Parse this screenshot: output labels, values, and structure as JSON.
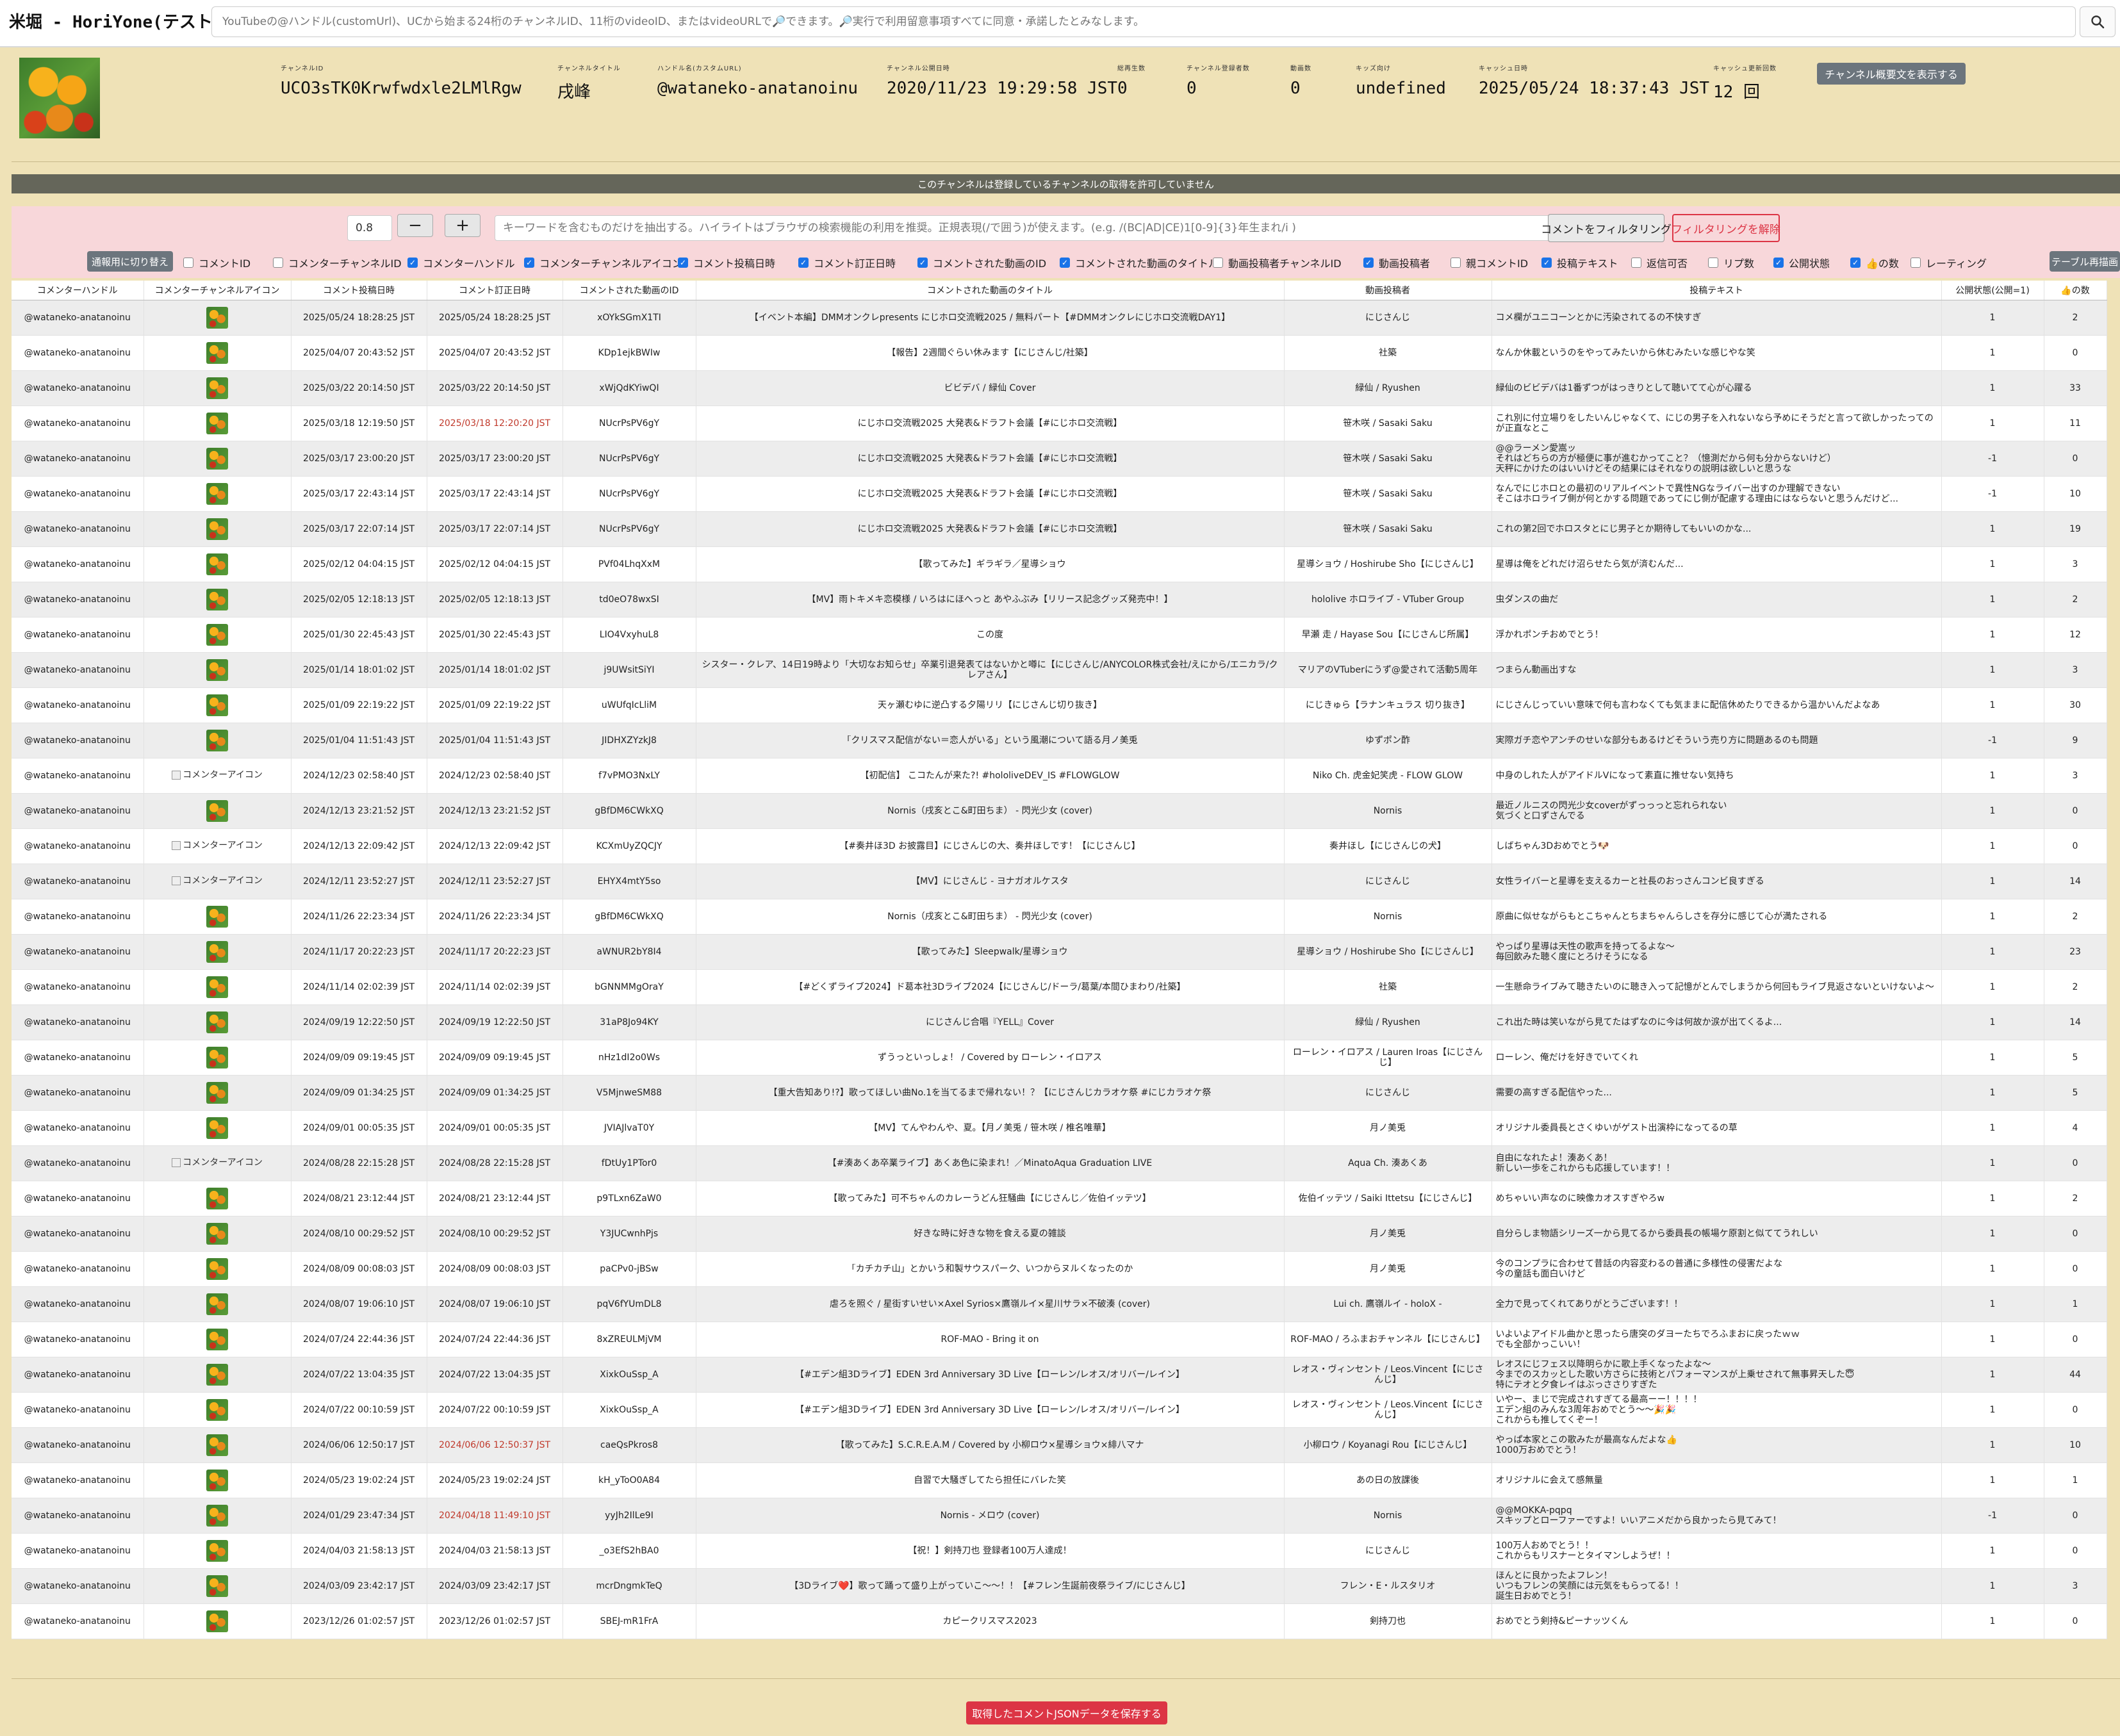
{
  "app": {
    "title": "米堀 - HoriYone(テスト中)",
    "search_placeholder": "YouTubeの@ハンドル(customUrl)、UCから始まる24桁のチャンネルID、11桁のvideoID、またはvideoURLで🔎できます。🔎実行で利用留意事項すべてに同意・承諾したとみなします。"
  },
  "channel": {
    "fields": [
      {
        "label": "チャンネルID",
        "value": "UCO3sTK0Krwfwdxle2LMlRgw"
      },
      {
        "label": "チャンネルタイトル",
        "value": "戌峰"
      },
      {
        "label": "ハンドル名(カスタムURL)",
        "value": "@wataneko-anatanoinu"
      },
      {
        "label": "チャンネル公開日時",
        "value": "2020/11/23 19:29:58 JST"
      },
      {
        "label": "総再生数",
        "value": "0"
      },
      {
        "label": "チャンネル登録者数",
        "value": "0"
      },
      {
        "label": "動画数",
        "value": "0"
      },
      {
        "label": "キッズ向け",
        "value": "undefined"
      },
      {
        "label": "キャッシュ日時",
        "value": "2025/05/24 18:37:43 JST"
      },
      {
        "label": "キャッシュ更新回数",
        "value": "12 回"
      }
    ],
    "desc_button": "チャンネル概要文を表示する"
  },
  "notice": "このチャンネルは登録しているチャンネルの取得を許可していません",
  "filter": {
    "threshold_value": "0.8",
    "minus": "−",
    "plus": "+",
    "keyword_placeholder": "キーワードを含むものだけを抽出する。ハイライトはブラウザの検索機能の利用を推奨。正規表現(/で囲う)が使えます。(e.g. /(BC|AD|CE)1[0-9]{3}年生まれ/i )",
    "filter_button": "コメントをフィルタリング",
    "clear_button": "フィルタリングを解除",
    "toggle_button": "通報用に切り替え",
    "redraw_button": "テーブル再描画",
    "columns": [
      {
        "label": "コメントID",
        "checked": false
      },
      {
        "label": "コメンターチャンネルID",
        "checked": false
      },
      {
        "label": "コメンターハンドル",
        "checked": true
      },
      {
        "label": "コメンターチャンネルアイコン",
        "checked": true
      },
      {
        "label": "コメント投稿日時",
        "checked": true
      },
      {
        "label": "コメント訂正日時",
        "checked": true
      },
      {
        "label": "コメントされた動画のID",
        "checked": true
      },
      {
        "label": "コメントされた動画のタイトル",
        "checked": true
      },
      {
        "label": "動画投稿者チャンネルID",
        "checked": false
      },
      {
        "label": "動画投稿者",
        "checked": true
      },
      {
        "label": "親コメントID",
        "checked": false
      },
      {
        "label": "投稿テキスト",
        "checked": true
      },
      {
        "label": "返信可否",
        "checked": false
      },
      {
        "label": "リプ数",
        "checked": false
      },
      {
        "label": "公開状態",
        "checked": true
      },
      {
        "label": "👍の数",
        "checked": true
      },
      {
        "label": "レーティング",
        "checked": false
      }
    ]
  },
  "table": {
    "headers": [
      "コメンターハンドル",
      "コメンターチャンネルアイコン",
      "コメント投稿日時",
      "コメント訂正日時",
      "コメントされた動画のID",
      "コメントされた動画のタイトル",
      "動画投稿者",
      "投稿テキスト",
      "公開状態(公開=1)",
      "👍の数"
    ],
    "broken_icon_alt": "コメンターアイコン",
    "rows": [
      {
        "handle": "@wataneko-anatanoinu",
        "icon": "img",
        "posted": "2025/05/24 18:28:25 JST",
        "edited": "2025/05/24 18:28:25 JST",
        "edited_red": false,
        "video_id": "xOYkSGmX1TI",
        "video_title": "【イベント本編】DMMオンクレpresents にじホロ交流戦2025 / 無料パート【#DMMオンクレにじホロ交流戦DAY1】",
        "uploader": "にじさんじ",
        "text": "コメ欄がユニコーンとかに汚染されてるの不快すぎ",
        "status": "1",
        "likes": "2"
      },
      {
        "handle": "@wataneko-anatanoinu",
        "icon": "img",
        "posted": "2025/04/07 20:43:52 JST",
        "edited": "2025/04/07 20:43:52 JST",
        "edited_red": false,
        "video_id": "KDp1ejkBWIw",
        "video_title": "【報告】2週間ぐらい休みます【にじさんじ/社築】",
        "uploader": "社築",
        "text": "なんか休載というのをやってみたいから休むみたいな感じやな笑",
        "status": "1",
        "likes": "0"
      },
      {
        "handle": "@wataneko-anatanoinu",
        "icon": "img",
        "posted": "2025/03/22 20:14:50 JST",
        "edited": "2025/03/22 20:14:50 JST",
        "edited_red": false,
        "video_id": "xWjQdKYiwQI",
        "video_title": "ビビデバ / 緑仙 Cover",
        "uploader": "緑仙 / Ryushen",
        "text": "緑仙のビビデバは1番ずつがはっきりとして聴いてて心が心躍る",
        "status": "1",
        "likes": "33"
      },
      {
        "handle": "@wataneko-anatanoinu",
        "icon": "img",
        "posted": "2025/03/18 12:19:50 JST",
        "edited": "2025/03/18 12:20:20 JST",
        "edited_red": true,
        "video_id": "NUcrPsPV6gY",
        "video_title": "にじホロ交流戦2025 大発表&ドラフト会議【#にじホロ交流戦】",
        "uploader": "笹木咲 / Sasaki Saku",
        "text": "これ別に付立場りをしたいんじゃなくて、にじの男子を入れないなら予めにそうだと言って欲しかったってのが正直なとこ",
        "status": "1",
        "likes": "11"
      },
      {
        "handle": "@wataneko-anatanoinu",
        "icon": "img",
        "posted": "2025/03/17 23:00:20 JST",
        "edited": "2025/03/17 23:00:20 JST",
        "edited_red": false,
        "video_id": "NUcrPsPV6gY",
        "video_title": "にじホロ交流戦2025 大発表&ドラフト会議【#にじホロ交流戦】",
        "uploader": "笹木咲 / Sasaki Saku",
        "text": "@@ラーメン愛嵩ッ\nそれはどちらの方が極便に事が進むかってこと？（憶測だから何も分からないけど）\n天秤にかけたのはいいけどその結果にはそれなりの説明は欲しいと思うな",
        "status": "-1",
        "likes": "0"
      },
      {
        "handle": "@wataneko-anatanoinu",
        "icon": "img",
        "posted": "2025/03/17 22:43:14 JST",
        "edited": "2025/03/17 22:43:14 JST",
        "edited_red": false,
        "video_id": "NUcrPsPV6gY",
        "video_title": "にじホロ交流戦2025 大発表&ドラフト会議【#にじホロ交流戦】",
        "uploader": "笹木咲 / Sasaki Saku",
        "text": "なんでにじホロとの最初のリアルイベントで異性NGなライバー出すのか理解できない\nそこはホロライブ側が何とかする問題であってにじ側が配慮する理由にはならないと思うんだけど...",
        "status": "-1",
        "likes": "10"
      },
      {
        "handle": "@wataneko-anatanoinu",
        "icon": "img",
        "posted": "2025/03/17 22:07:14 JST",
        "edited": "2025/03/17 22:07:14 JST",
        "edited_red": false,
        "video_id": "NUcrPsPV6gY",
        "video_title": "にじホロ交流戦2025 大発表&ドラフト会議【#にじホロ交流戦】",
        "uploader": "笹木咲 / Sasaki Saku",
        "text": "これの第2回でホロスタとにじ男子とか期待してもいいのかな...",
        "status": "1",
        "likes": "19"
      },
      {
        "handle": "@wataneko-anatanoinu",
        "icon": "img",
        "posted": "2025/02/12 04:04:15 JST",
        "edited": "2025/02/12 04:04:15 JST",
        "edited_red": false,
        "video_id": "PVf04LhqXxM",
        "video_title": "【歌ってみた】ギラギラ／星導ショウ",
        "uploader": "星導ショウ / Hoshirube Sho【にじさんじ】",
        "text": "星導は俺をどれだけ沼らせたら気が済むんだ...",
        "status": "1",
        "likes": "3"
      },
      {
        "handle": "@wataneko-anatanoinu",
        "icon": "img",
        "posted": "2025/02/05 12:18:13 JST",
        "edited": "2025/02/05 12:18:13 JST",
        "edited_red": false,
        "video_id": "td0eO78wxSI",
        "video_title": "【MV】雨トキメキ恋模様 / いろはにほへっと あやふぶみ【リリース記念グッズ発売中！】",
        "uploader": "hololive ホロライブ - VTuber Group",
        "text": "虫ダンスの曲だ",
        "status": "1",
        "likes": "2"
      },
      {
        "handle": "@wataneko-anatanoinu",
        "icon": "img",
        "posted": "2025/01/30 22:45:43 JST",
        "edited": "2025/01/30 22:45:43 JST",
        "edited_red": false,
        "video_id": "LIO4VxyhuL8",
        "video_title": "この度",
        "uploader": "早瀬 走 / Hayase Sou【にじさんじ所属】",
        "text": "浮かれポンチおめでとう！",
        "status": "1",
        "likes": "12"
      },
      {
        "handle": "@wataneko-anatanoinu",
        "icon": "img",
        "posted": "2025/01/14 18:01:02 JST",
        "edited": "2025/01/14 18:01:02 JST",
        "edited_red": false,
        "video_id": "j9UWsitSiYI",
        "video_title": "シスター・クレア、14日19時より「大切なお知らせ」卒業引退発表てはないかと噂に【にじさんじ/ANYCOLOR株式会社/えにから/エニカラ/クレアさん】",
        "uploader": "マリアのVTuberにうず@愛されて活動5周年",
        "text": "つまらん動画出すな",
        "status": "1",
        "likes": "3"
      },
      {
        "handle": "@wataneko-anatanoinu",
        "icon": "img",
        "posted": "2025/01/09 22:19:22 JST",
        "edited": "2025/01/09 22:19:22 JST",
        "edited_red": false,
        "video_id": "uWUfqIcLliM",
        "video_title": "天ヶ瀬むゆに逆凸する夕陽リリ【にじさんじ切り抜き】",
        "uploader": "にじきゅら【ラナンキュラス 切り抜き】",
        "text": "にじさんじっていい意味で何も言わなくても気ままに配信休めたりできるから温かいんだよなあ",
        "status": "1",
        "likes": "30"
      },
      {
        "handle": "@wataneko-anatanoinu",
        "icon": "img",
        "posted": "2025/01/04 11:51:43 JST",
        "edited": "2025/01/04 11:51:43 JST",
        "edited_red": false,
        "video_id": "JIDHXZYzkJ8",
        "video_title": "「クリスマス配信がない＝恋人がいる」という風潮について語る月ノ美兎",
        "uploader": "ゆずポン酢",
        "text": "実際ガチ恋やアンチのせいな部分もあるけどそういう売り方に問題あるのも問題",
        "status": "-1",
        "likes": "9"
      },
      {
        "handle": "@wataneko-anatanoinu",
        "icon": "broken",
        "posted": "2024/12/23 02:58:40 JST",
        "edited": "2024/12/23 02:58:40 JST",
        "edited_red": false,
        "video_id": "f7vPMO3NxLY",
        "video_title": "【初配信】 こコたんが来た?! #hololiveDEV_IS #FLOWGLOW",
        "uploader": "Niko Ch. 虎金妃笑虎 - FLOW GLOW",
        "text": "中身のしれた人がアイドルVになって素直に推せない気持ち",
        "status": "1",
        "likes": "3"
      },
      {
        "handle": "@wataneko-anatanoinu",
        "icon": "img",
        "posted": "2024/12/13 23:21:52 JST",
        "edited": "2024/12/13 23:21:52 JST",
        "edited_red": false,
        "video_id": "gBfDM6CWkXQ",
        "video_title": "Nornis（戌亥とこ&町田ちま） - 閃光少女 (cover)",
        "uploader": "Nornis",
        "text": "最近ノルニスの閃光少女coverがずっっっと忘れられない\n気づくと口ずさんでる",
        "status": "1",
        "likes": "0"
      },
      {
        "handle": "@wataneko-anatanoinu",
        "icon": "broken",
        "posted": "2024/12/13 22:09:42 JST",
        "edited": "2024/12/13 22:09:42 JST",
        "edited_red": false,
        "video_id": "KCXmUyZQCJY",
        "video_title": "【#奏井ほ3D お披露目】にじさんじの大、奏井ほしです！【にじさんじ】",
        "uploader": "奏井ほし【にじさんじの犬】",
        "text": "しばちゃん3Dおめでとう🐶",
        "status": "1",
        "likes": "0"
      },
      {
        "handle": "@wataneko-anatanoinu",
        "icon": "broken",
        "posted": "2024/12/11 23:52:27 JST",
        "edited": "2024/12/11 23:52:27 JST",
        "edited_red": false,
        "video_id": "EHYX4mtY5so",
        "video_title": "【MV】にじさんじ - ヨナガオルケスタ",
        "uploader": "にじさんじ",
        "text": "女性ライバーと星導を支えるカーと社長のおっさんコンビ良すぎる",
        "status": "1",
        "likes": "14"
      },
      {
        "handle": "@wataneko-anatanoinu",
        "icon": "img",
        "posted": "2024/11/26 22:23:34 JST",
        "edited": "2024/11/26 22:23:34 JST",
        "edited_red": false,
        "video_id": "gBfDM6CWkXQ",
        "video_title": "Nornis（戌亥とこ&町田ちま） - 閃光少女 (cover)",
        "uploader": "Nornis",
        "text": "原曲に似せながらもとこちゃんとちまちゃんらしさを存分に感じて心が満たされる",
        "status": "1",
        "likes": "2"
      },
      {
        "handle": "@wataneko-anatanoinu",
        "icon": "img",
        "posted": "2024/11/17 20:22:23 JST",
        "edited": "2024/11/17 20:22:23 JST",
        "edited_red": false,
        "video_id": "aWNUR2bY8I4",
        "video_title": "【歌ってみた】Sleepwalk/星導ショウ",
        "uploader": "星導ショウ / Hoshirube Sho【にじさんじ】",
        "text": "やっぱり星導は天性の歌声を持ってるよな〜\n毎回飲みた聴く度にとろけそうになる",
        "status": "1",
        "likes": "23"
      },
      {
        "handle": "@wataneko-anatanoinu",
        "icon": "img",
        "posted": "2024/11/14 02:02:39 JST",
        "edited": "2024/11/14 02:02:39 JST",
        "edited_red": false,
        "video_id": "bGNNMMgOraY",
        "video_title": "【#どくずライブ2024】ド葛本社3Dライブ2024【にじさんじ/ドーラ/葛葉/本間ひまわり/社築】",
        "uploader": "社築",
        "text": "一生懸命ライブみて聴きたいのに聴き入って記憶がとんでしまうから何回もライブ見返さないといけないよ〜",
        "status": "1",
        "likes": "2"
      },
      {
        "handle": "@wataneko-anatanoinu",
        "icon": "img",
        "posted": "2024/09/19 12:22:50 JST",
        "edited": "2024/09/19 12:22:50 JST",
        "edited_red": false,
        "video_id": "31aP8Jo94KY",
        "video_title": "にじさんじ合唱『YELL』Cover",
        "uploader": "緑仙 / Ryushen",
        "text": "これ出た時は笑いながら見てたはずなのに今は何故か涙が出てくるよ...",
        "status": "1",
        "likes": "14"
      },
      {
        "handle": "@wataneko-anatanoinu",
        "icon": "img",
        "posted": "2024/09/09 09:19:45 JST",
        "edited": "2024/09/09 09:19:45 JST",
        "edited_red": false,
        "video_id": "nHz1dI2o0Ws",
        "video_title": "ずうっといっしょ！ / Covered by ローレン・イロアス",
        "uploader": "ローレン・イロアス / Lauren Iroas【にじさんじ】",
        "text": "ローレン、俺だけを好きでいてくれ",
        "status": "1",
        "likes": "5"
      },
      {
        "handle": "@wataneko-anatanoinu",
        "icon": "img",
        "posted": "2024/09/09 01:34:25 JST",
        "edited": "2024/09/09 01:34:25 JST",
        "edited_red": false,
        "video_id": "V5MjnweSM88",
        "video_title": "【重大告知あり!?】歌ってほしい曲No.1を当てるまで帰れない！？【にじさんじカラオケ祭 #にじカラオケ祭",
        "uploader": "にじさんじ",
        "text": "需要の高すぎる配信やった...",
        "status": "1",
        "likes": "5"
      },
      {
        "handle": "@wataneko-anatanoinu",
        "icon": "img",
        "posted": "2024/09/01 00:05:35 JST",
        "edited": "2024/09/01 00:05:35 JST",
        "edited_red": false,
        "video_id": "JVIAJlvaT0Y",
        "video_title": "【MV】てんやわんや、夏。【月ノ美兎 / 笹木咲 / 椎名唯華】",
        "uploader": "月ノ美兎",
        "text": "オリジナル委員長とさくゆいがゲスト出演枠になってるの草",
        "status": "1",
        "likes": "4"
      },
      {
        "handle": "@wataneko-anatanoinu",
        "icon": "broken",
        "posted": "2024/08/28 22:15:28 JST",
        "edited": "2024/08/28 22:15:28 JST",
        "edited_red": false,
        "video_id": "fDtUy1PTor0",
        "video_title": "【#湊あくあ卒業ライブ】あくあ色に染まれ！／MinatoAqua Graduation LIVE",
        "uploader": "Aqua Ch. 湊あくあ",
        "text": "自由になれたよ！湊あくあ！\n新しい一歩をこれからも応援しています！！",
        "status": "1",
        "likes": "0"
      },
      {
        "handle": "@wataneko-anatanoinu",
        "icon": "img",
        "posted": "2024/08/21 23:12:44 JST",
        "edited": "2024/08/21 23:12:44 JST",
        "edited_red": false,
        "video_id": "p9TLxn6ZaW0",
        "video_title": "【歌ってみた】可不ちゃんのカレーうどん狂騒曲【にじさんじ／佐伯イッテツ】",
        "uploader": "佐伯イッテツ / Saiki Ittetsu【にじさんじ】",
        "text": "めちゃいい声なのに映像カオスすぎやろw",
        "status": "1",
        "likes": "2"
      },
      {
        "handle": "@wataneko-anatanoinu",
        "icon": "img",
        "posted": "2024/08/10 00:29:52 JST",
        "edited": "2024/08/10 00:29:52 JST",
        "edited_red": false,
        "video_id": "Y3JUCwnhPjs",
        "video_title": "好きな時に好きな物を食える夏の雑談",
        "uploader": "月ノ美兎",
        "text": "自分らしま物語シリーズ一から見てるから委員長の帳場ケ原割と似ててうれしい",
        "status": "1",
        "likes": "0"
      },
      {
        "handle": "@wataneko-anatanoinu",
        "icon": "img",
        "posted": "2024/08/09 00:08:03 JST",
        "edited": "2024/08/09 00:08:03 JST",
        "edited_red": false,
        "video_id": "paCPv0-jBSw",
        "video_title": "「カチカチ山」とかいう和製サウスパーク、いつからヌルくなったのか",
        "uploader": "月ノ美兎",
        "text": "今のコンプラに合わせて昔話の内容変わるの普通に多様性の侵害だよな\n今の童話も面白いけど",
        "status": "1",
        "likes": "0"
      },
      {
        "handle": "@wataneko-anatanoinu",
        "icon": "img",
        "posted": "2024/08/07 19:06:10 JST",
        "edited": "2024/08/07 19:06:10 JST",
        "edited_red": false,
        "video_id": "pqV6fYUmDL8",
        "video_title": "虐ろを照ぐ / 星街すいせい×Axel Syrios×鷹嶺ルイ×星川サラ×不破湊 (cover)",
        "uploader": "Lui ch. 鷹嶺ルイ - holoX -",
        "text": "全力で見ってくれてありがとうございます！！",
        "status": "1",
        "likes": "1"
      },
      {
        "handle": "@wataneko-anatanoinu",
        "icon": "img",
        "posted": "2024/07/24 22:44:36 JST",
        "edited": "2024/07/24 22:44:36 JST",
        "edited_red": false,
        "video_id": "8xZREULMjVM",
        "video_title": "ROF-MAO - Bring it on",
        "uploader": "ROF-MAO / ろふまおチャンネル【にじさんじ】",
        "text": "いよいよアイドル曲かと思ったら唐突のダヨーたちでろふまおに戻ったｗｗ\nでも全部かっこいい！",
        "status": "1",
        "likes": "0"
      },
      {
        "handle": "@wataneko-anatanoinu",
        "icon": "img",
        "posted": "2024/07/22 13:04:35 JST",
        "edited": "2024/07/22 13:04:35 JST",
        "edited_red": false,
        "video_id": "XixkOuSsp_A",
        "video_title": "【#エデン組3Dライブ】EDEN 3rd Anniversary 3D Live【ローレン/レオス/オリバー/レイン】",
        "uploader": "レオス・ヴィンセント / Leos.Vincent【にじさんじ】",
        "text": "レオスにじフェス以降明らかに歌上手くなったよな〜\n今までのスカッとした歌い方さらに技術とパフォーマンスが上乗せされて無事昇天した😇\n特にテオと夕食レイはぶっささりすぎた",
        "status": "1",
        "likes": "44"
      },
      {
        "handle": "@wataneko-anatanoinu",
        "icon": "img",
        "posted": "2024/07/22 00:10:59 JST",
        "edited": "2024/07/22 00:10:59 JST",
        "edited_red": false,
        "video_id": "XixkOuSsp_A",
        "video_title": "【#エデン組3Dライブ】EDEN 3rd Anniversary 3D Live【ローレン/レオス/オリバー/レイン】",
        "uploader": "レオス・ヴィンセント / Leos.Vincent【にじさんじ】",
        "text": "いやー、まじで完成されすぎてる最高ーー！！！！\nエデン組のみんな3周年おめでとう〜〜🎉🎉\nこれからも推してくぞー！",
        "status": "1",
        "likes": "0"
      },
      {
        "handle": "@wataneko-anatanoinu",
        "icon": "img",
        "posted": "2024/06/06 12:50:17 JST",
        "edited": "2024/06/06 12:50:37 JST",
        "edited_red": true,
        "video_id": "caeQsPkros8",
        "video_title": "【歌ってみた】S.C.R.E.A.M / Covered by 小柳ロウ×星導ショウ×緋八マナ",
        "uploader": "小柳ロウ / Koyanagi Rou【にじさんじ】",
        "text": "やっぱ本家とこの歌みたが最高なんだよな👍\n1000万おめでとう！",
        "status": "1",
        "likes": "10"
      },
      {
        "handle": "@wataneko-anatanoinu",
        "icon": "img",
        "posted": "2024/05/23 19:02:24 JST",
        "edited": "2024/05/23 19:02:24 JST",
        "edited_red": false,
        "video_id": "kH_yToO0A84",
        "video_title": "自習で大騒ぎしてたら担任にバレた笑",
        "uploader": "あの日の放課後",
        "text": "オリジナルに会えて感無量",
        "status": "1",
        "likes": "1"
      },
      {
        "handle": "@wataneko-anatanoinu",
        "icon": "img",
        "posted": "2024/01/29 23:47:34 JST",
        "edited": "2024/04/18 11:49:10 JST",
        "edited_red": true,
        "video_id": "yyJh2IlLe9I",
        "video_title": "Nornis - メロウ (cover)",
        "uploader": "Nornis",
        "text": "@@MOKKA-pqpq\nスキップとローファーですよ！いいアニメだから良かったら見てみて！",
        "status": "-1",
        "likes": "0"
      },
      {
        "handle": "@wataneko-anatanoinu",
        "icon": "img",
        "posted": "2024/04/03 21:58:13 JST",
        "edited": "2024/04/03 21:58:13 JST",
        "edited_red": false,
        "video_id": "_o3EfS2hBA0",
        "video_title": "【祝！】剣持刀也 登録者100万人達成！",
        "uploader": "にじさんじ",
        "text": "100万人おめでとう！！\nこれからもリスナーとタイマンしようぜ！！",
        "status": "1",
        "likes": "0"
      },
      {
        "handle": "@wataneko-anatanoinu",
        "icon": "img",
        "posted": "2024/03/09 23:42:17 JST",
        "edited": "2024/03/09 23:42:17 JST",
        "edited_red": false,
        "video_id": "mcrDngmkTeQ",
        "video_title": "【3Dライブ❤️】歌って踊って盛り上がっていこ〜〜！！【#フレン生誕前夜祭ライブ/にじさんじ】",
        "uploader": "フレン・E・ルスタリオ",
        "text": "ほんとに良かったよフレン！\nいつもフレンの笑顔には元気をもらってる！！\n誕生日おめでとう！",
        "status": "1",
        "likes": "3"
      },
      {
        "handle": "@wataneko-anatanoinu",
        "icon": "img",
        "posted": "2023/12/26 01:02:57 JST",
        "edited": "2023/12/26 01:02:57 JST",
        "edited_red": false,
        "video_id": "SBEJ-mR1FrA",
        "video_title": "カピークリスマス2023",
        "uploader": "剣持刀也",
        "text": "おめでとう剣持&ピーナッツくん",
        "status": "1",
        "likes": "0"
      }
    ]
  },
  "save_button": "取得したコメントJSONデータを保存する",
  "colors": {
    "accent_red": "#dc3545",
    "gray_button": "#6c757d",
    "page_bg": "#efe2b7",
    "filter_bg": "#f8d7da",
    "checkbox_on": "#1a73e8"
  }
}
